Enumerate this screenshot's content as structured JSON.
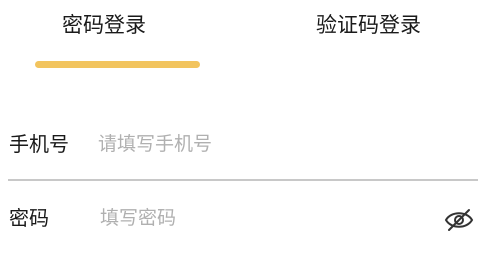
{
  "tabs": {
    "password_login": "密码登录",
    "code_login": "验证码登录",
    "active": "password_login",
    "indicator_color": "#f2c45e"
  },
  "phone": {
    "label": "手机号",
    "value": "",
    "placeholder": "请填写手机号"
  },
  "password": {
    "label": "密码",
    "value": "",
    "placeholder": "填写密码",
    "visibility_icon": "eye-slash-icon"
  }
}
